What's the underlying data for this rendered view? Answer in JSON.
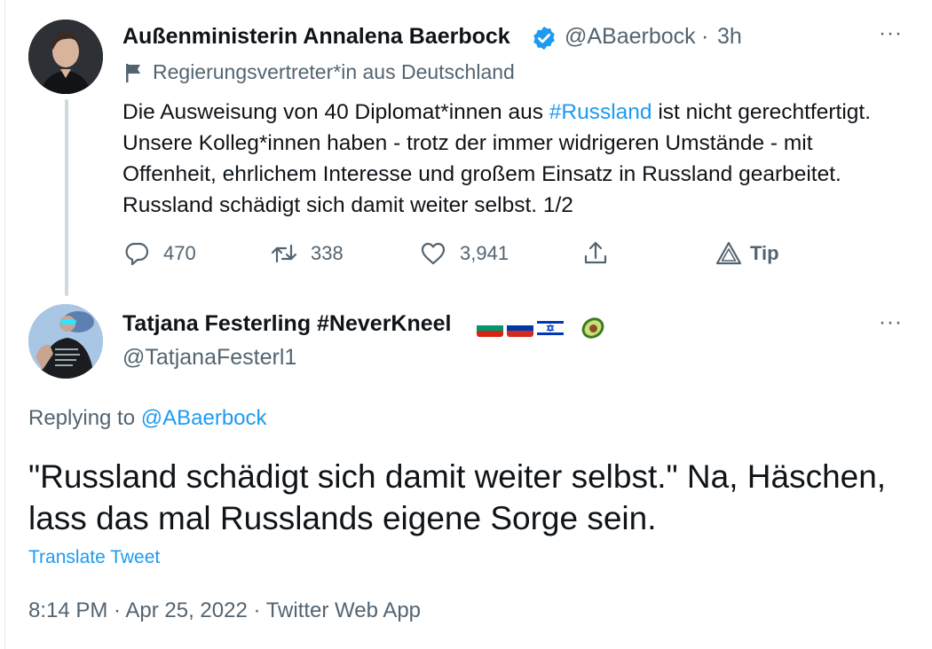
{
  "parent_tweet": {
    "name": "Außenministerin Annalena Baerbock",
    "handle": "@ABaerbock",
    "separator": "·",
    "time": "3h",
    "more": "···",
    "context_label": "Regierungsvertreter*in aus Deutschland",
    "text_before": "Die Ausweisung von 40 Diplomat*innen aus ",
    "hashtag": "#Russland",
    "text_after": " ist nicht gerechtfertigt. Unsere Kolleg*innen haben - trotz der immer widrigeren Umstände - mit Offenheit, ehrlichem Interesse und großem Einsatz in Russland gearbeitet. Russland schädigt sich damit weiter selbst. 1/2",
    "replies": "470",
    "retweets": "338",
    "likes": "3,941",
    "tip_label": "Tip"
  },
  "reply_tweet": {
    "name": "Tatjana Festerling #NeverKneel",
    "handle": "@TatjanaFesterl1",
    "more": "···",
    "replying_prefix": "Replying to ",
    "replying_mention": "@ABaerbock",
    "text": "\"Russland schädigt sich damit weiter selbst.\" Na, Häschen, lass das mal Russlands eigene Sorge sein.",
    "translate_label": "Translate Tweet",
    "meta": "8:14 PM · Apr 25, 2022 · Twitter Web App"
  },
  "colors": {
    "link": "#1d9bf0",
    "secondary_text": "#536471",
    "primary_text": "#0f1419",
    "thread_line": "#cfd9de"
  },
  "flags": [
    "bulgaria-flag",
    "russia-flag",
    "israel-flag",
    "avocado-icon"
  ]
}
